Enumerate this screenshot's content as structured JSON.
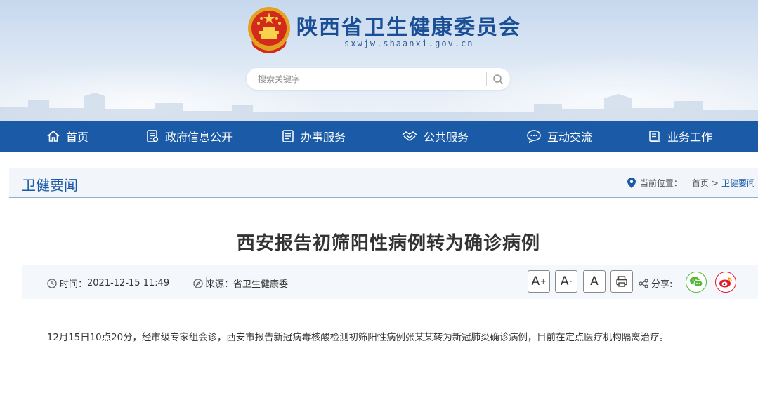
{
  "header": {
    "site_title": "陕西省卫生健康委员会",
    "site_domain": "sxwjw.shaanxi.gov.cn",
    "emblem_icon": "national-emblem-icon",
    "search": {
      "placeholder": "搜索关键字",
      "value": "",
      "icon": "search-icon"
    }
  },
  "nav": {
    "items": [
      {
        "label": "首页",
        "icon": "home-icon"
      },
      {
        "label": "政府信息公开",
        "icon": "document-icon"
      },
      {
        "label": "办事服务",
        "icon": "service-list-icon"
      },
      {
        "label": "公共服务",
        "icon": "handshake-icon"
      },
      {
        "label": "互动交流",
        "icon": "chat-icon"
      },
      {
        "label": "业务工作",
        "icon": "books-icon"
      }
    ]
  },
  "section": {
    "title": "卫健要闻",
    "breadcrumb": {
      "label": "当前位置：",
      "home": "首页",
      "separator": ">",
      "current": "卫健要闻"
    }
  },
  "article": {
    "title": "西安报告初筛阳性病例转为确诊病例",
    "meta": {
      "time_label": "时间：",
      "time_value": "2021-12-15 11:49",
      "source_label": "来源：",
      "source_value": "省卫生健康委"
    },
    "font_buttons": [
      "A",
      "A",
      "A"
    ],
    "share_label": "分享:",
    "body": "12月15日10点20分，经市级专家组会诊，西安市报告新冠病毒核酸检测初筛阳性病例张某某转为新冠肺炎确诊病例，目前在定点医疗机构隔离治疗。"
  },
  "colors": {
    "brand_blue": "#1b5aa6",
    "title_blue": "#1a4f96",
    "wechat_green": "#55b837",
    "weibo_red": "#e6162d"
  }
}
